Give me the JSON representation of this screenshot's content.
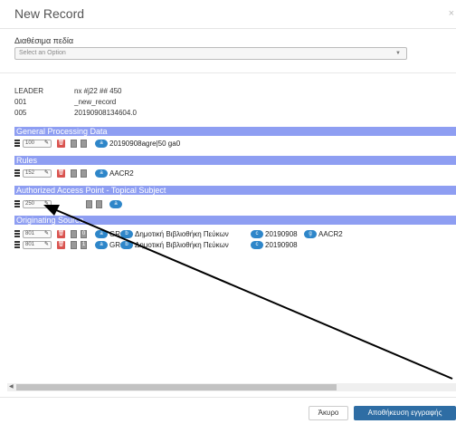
{
  "dialog": {
    "title": "New Record",
    "close": "×"
  },
  "fields": {
    "label": "Διαθέσιμα πεδία",
    "placeholder": "Select an Option",
    "caret": "▼"
  },
  "control_fields": [
    {
      "tag": "LEADER",
      "value": "nx #j22 ## 450"
    },
    {
      "tag": "001",
      "value": "_new_record"
    },
    {
      "tag": "005",
      "value": "20190908134604.0"
    }
  ],
  "sections": [
    {
      "title": "General Processing Data",
      "rows": [
        {
          "tag": "100",
          "ind1": "",
          "ind2": "",
          "subfields": [
            {
              "code": "a",
              "value": "20190908agre|50 ga0"
            }
          ]
        }
      ]
    },
    {
      "title": "Rules",
      "rows": [
        {
          "tag": "152",
          "ind1": "",
          "ind2": "",
          "subfields": [
            {
              "code": "a",
              "value": "AACR2"
            }
          ]
        }
      ]
    },
    {
      "title": "Authorized Access Point - Topical Subject",
      "rows": [
        {
          "tag": "250",
          "ind1": "",
          "ind2": "",
          "subfields": [
            {
              "code": "a",
              "value": ""
            }
          ]
        }
      ]
    },
    {
      "title": "Originating Source",
      "rows": [
        {
          "tag": "801",
          "ind1": "",
          "ind2": "0",
          "subfields": [
            {
              "code": "a",
              "value": "GR"
            },
            {
              "code": "b",
              "value": "Δημοτική Βιβλιοθήκη Πεύκων"
            },
            {
              "code": "c",
              "value": "20190908"
            },
            {
              "code": "g",
              "value": "AACR2"
            }
          ]
        },
        {
          "tag": "801",
          "ind1": "",
          "ind2": "1",
          "subfields": [
            {
              "code": "a",
              "value": "GR"
            },
            {
              "code": "b",
              "value": "Δημοτική Βιβλιοθήκη Πεύκων"
            },
            {
              "code": "c",
              "value": "20190908"
            }
          ]
        }
      ]
    }
  ],
  "buttons": {
    "cancel": "Άκυρο",
    "save": "Αποθήκευση εγγραφής"
  },
  "icons": {
    "edit": "pencil-icon",
    "delete": "trash-icon",
    "menu": "hamburger-icon"
  },
  "colors": {
    "section_bg": "#8e9ef2",
    "subfield_badge": "#2e86c9",
    "delete": "#d9534f",
    "save_button": "#2e6da4"
  }
}
